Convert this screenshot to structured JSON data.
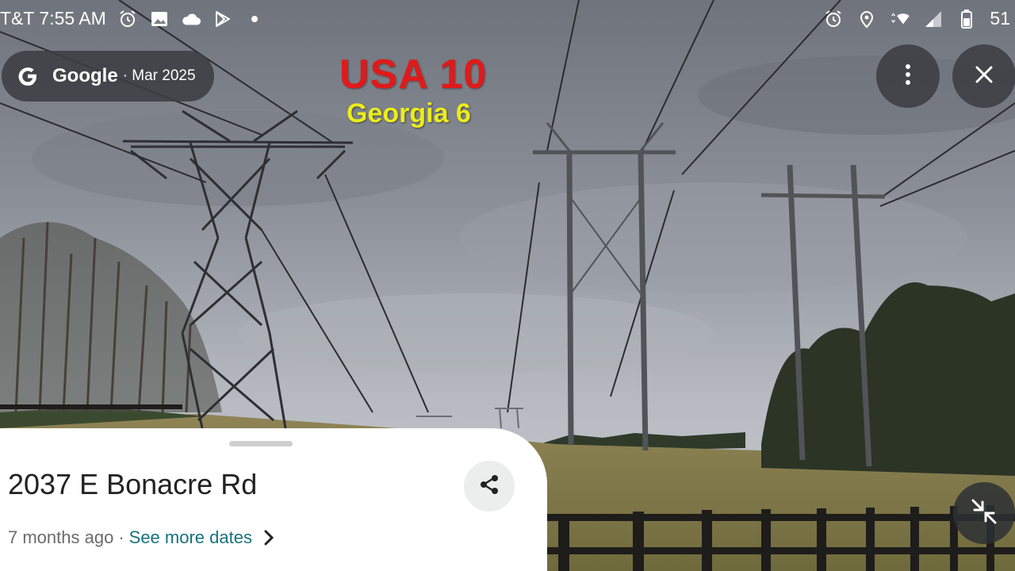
{
  "status_bar": {
    "carrier_time": "T&T  7:55 AM",
    "battery": "51"
  },
  "header": {
    "brand": "Google",
    "date": "· Mar 2025"
  },
  "overlay_title": {
    "line1": "USA 10",
    "line2": "Georgia 6"
  },
  "place": {
    "address": "2037 E Bonacre Rd",
    "time_ago": "7 months ago",
    "separator": "·",
    "see_more": "See more dates"
  },
  "icons": {
    "alarm": "alarm-icon",
    "gallery": "gallery-icon",
    "cloud": "cloud-icon",
    "play": "play-store-icon",
    "location": "location-pin-icon",
    "wifi": "wifi-icon",
    "signal": "signal-icon",
    "battery": "battery-icon",
    "more": "more-vert-icon",
    "close": "close-icon",
    "share": "share-icon",
    "collapse": "collapse-icon",
    "chevron": "chevron-right-icon"
  },
  "colors": {
    "red_title": "#e01a1a",
    "yellow_title": "#ecec1c",
    "link_teal": "#16727c",
    "pill_bg": "#3c3e42"
  }
}
